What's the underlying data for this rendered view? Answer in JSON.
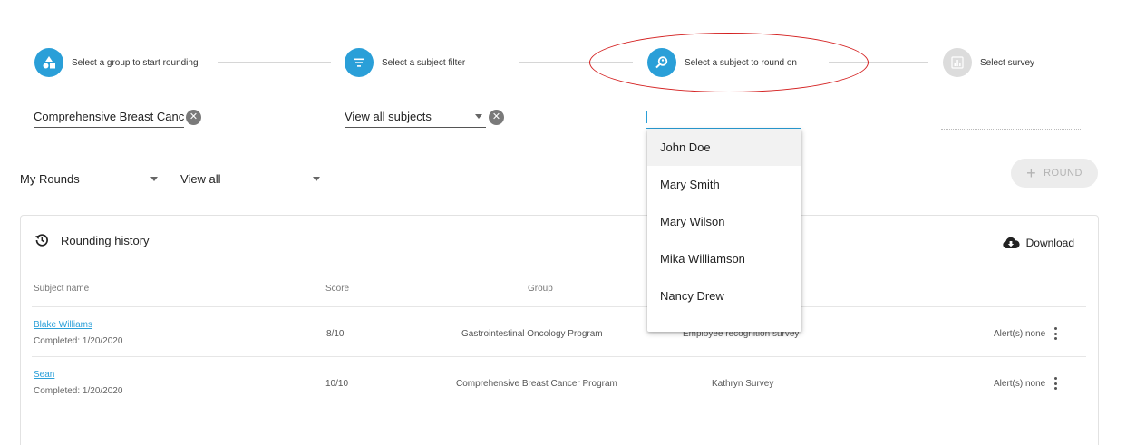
{
  "stepper": {
    "steps": [
      {
        "label": "Select a group to start rounding",
        "icon": "shapes-icon",
        "state": "active"
      },
      {
        "label": "Select a subject filter",
        "icon": "filter-icon",
        "state": "active"
      },
      {
        "label": "Select a subject to round on",
        "icon": "search-person-icon",
        "state": "active"
      },
      {
        "label": "Select survey",
        "icon": "bar-chart-icon",
        "state": "inactive"
      }
    ]
  },
  "filters": {
    "group_value": "Comprehensive Breast Canc",
    "subject_filter_value": "View all subjects",
    "subject_search_value": ""
  },
  "dropdowns": {
    "rounds_value": "My Rounds",
    "view_value": "View all"
  },
  "round_button": {
    "label": "ROUND"
  },
  "history": {
    "title": "Rounding history",
    "download_label": "Download",
    "columns": [
      "Subject name",
      "Score",
      "Group"
    ],
    "rows": [
      {
        "name": "Blake Williams",
        "completed": "Completed: 1/20/2020",
        "score": "8/10",
        "group": "Gastrointestinal Oncology Program",
        "survey": "Employee recognition survey",
        "alerts": "Alert(s) none"
      },
      {
        "name": "Sean",
        "completed": "Completed: 1/20/2020",
        "score": "10/10",
        "group": "Comprehensive Breast Cancer Program",
        "survey": "Kathryn Survey",
        "alerts": "Alert(s) none"
      }
    ]
  },
  "subject_options": [
    "John Doe",
    "Mary Smith",
    "Mary Wilson",
    "Mika Williamson",
    "Nancy Drew"
  ],
  "colors": {
    "accent": "#2a9fd8",
    "annotation": "#d42020"
  }
}
